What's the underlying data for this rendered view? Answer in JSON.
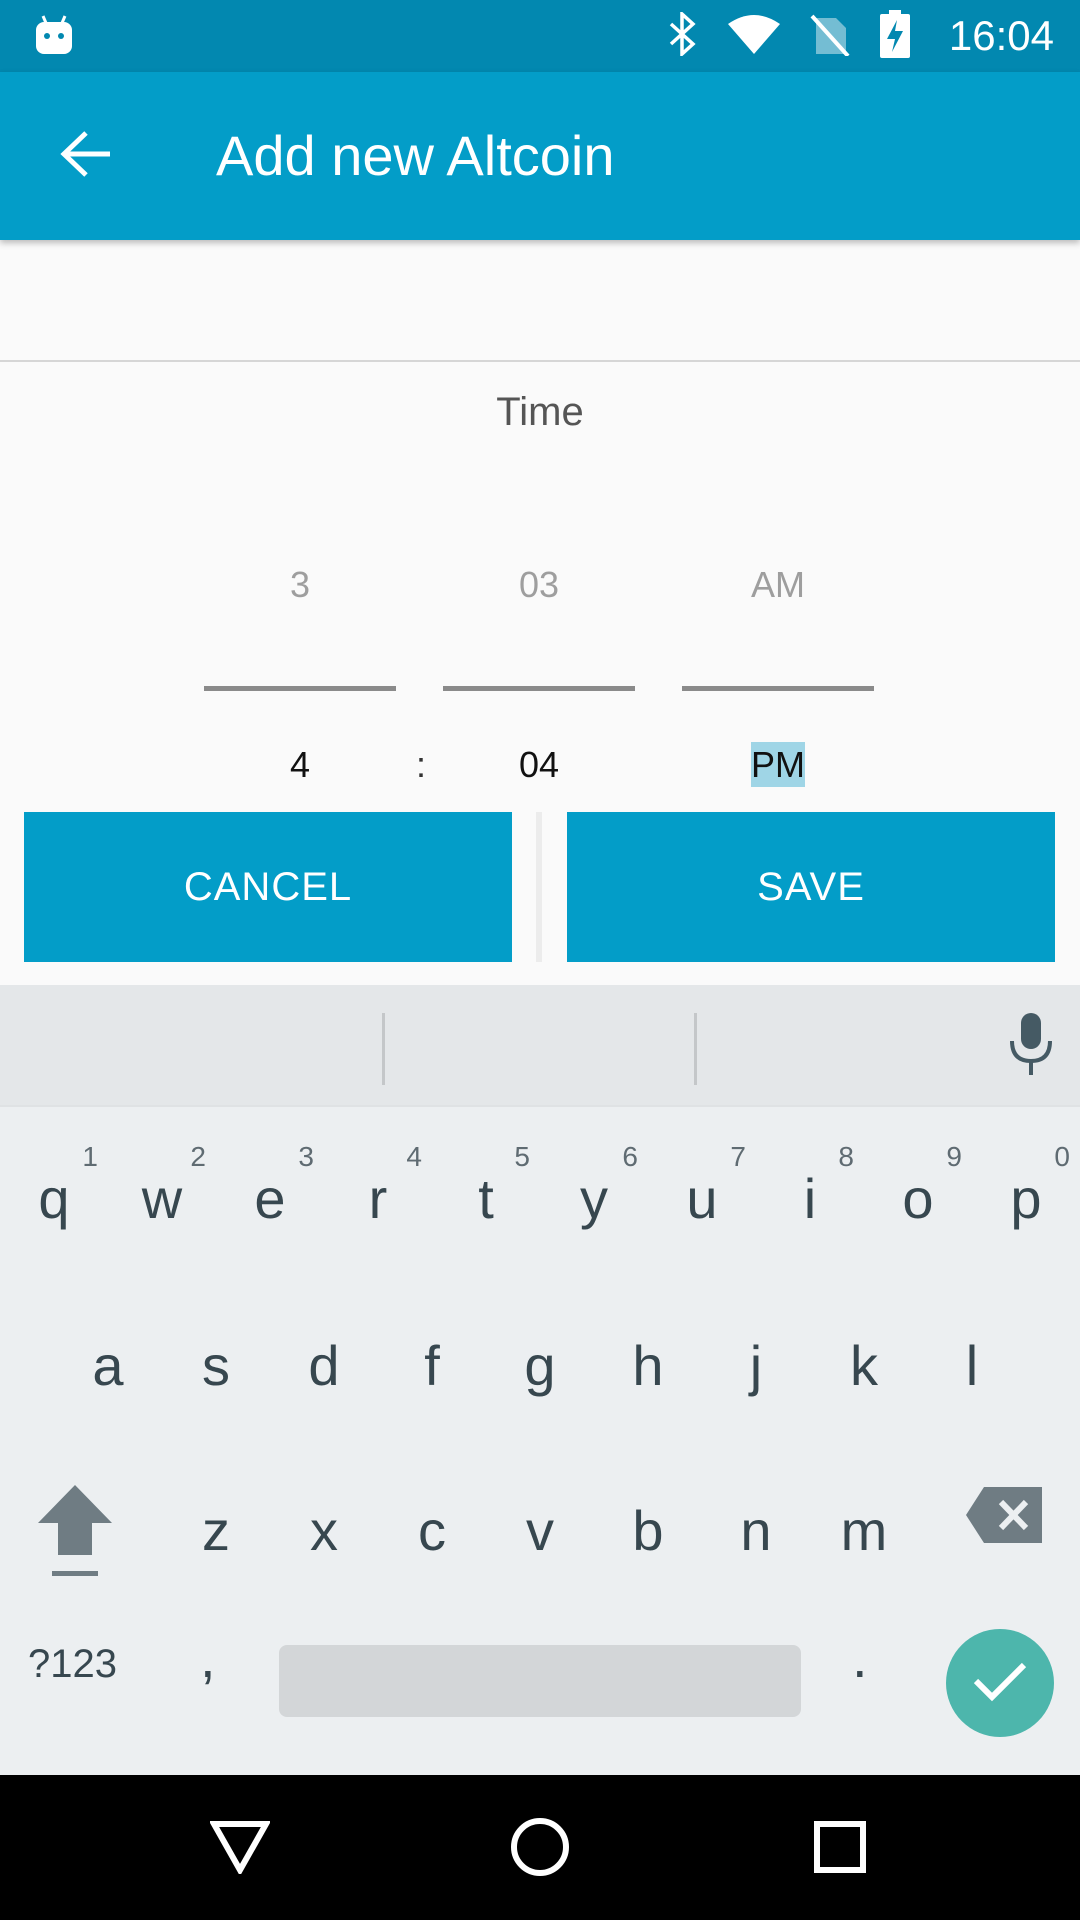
{
  "status_bar": {
    "time": "16:04",
    "icons": [
      "android-icon",
      "bluetooth-icon",
      "wifi-icon",
      "no-sim-icon",
      "battery-charging-icon"
    ]
  },
  "app_bar": {
    "title": "Add new Altcoin",
    "back_icon": "arrow-back-icon"
  },
  "time_picker": {
    "title": "Time",
    "hour": {
      "previous": "3",
      "current": "4"
    },
    "separator": ":",
    "minute": {
      "previous": "03",
      "current": "04"
    },
    "ampm": {
      "previous": "AM",
      "current": "PM"
    }
  },
  "buttons": {
    "cancel": "CANCEL",
    "save": "SAVE"
  },
  "keyboard": {
    "row1": [
      {
        "key": "q",
        "hint": "1"
      },
      {
        "key": "w",
        "hint": "2"
      },
      {
        "key": "e",
        "hint": "3"
      },
      {
        "key": "r",
        "hint": "4"
      },
      {
        "key": "t",
        "hint": "5"
      },
      {
        "key": "y",
        "hint": "6"
      },
      {
        "key": "u",
        "hint": "7"
      },
      {
        "key": "i",
        "hint": "8"
      },
      {
        "key": "o",
        "hint": "9"
      },
      {
        "key": "p",
        "hint": "0"
      }
    ],
    "row2": [
      "a",
      "s",
      "d",
      "f",
      "g",
      "h",
      "j",
      "k",
      "l"
    ],
    "row3": [
      "z",
      "x",
      "c",
      "v",
      "b",
      "n",
      "m"
    ],
    "symbols": "?123",
    "comma": ",",
    "period": "."
  },
  "colors": {
    "status_bar": "#0288b0",
    "app_bar": "#039dc8",
    "button": "#039dc8",
    "enter_key": "#4db6ac",
    "selection_highlight": "#9fd5e6"
  }
}
